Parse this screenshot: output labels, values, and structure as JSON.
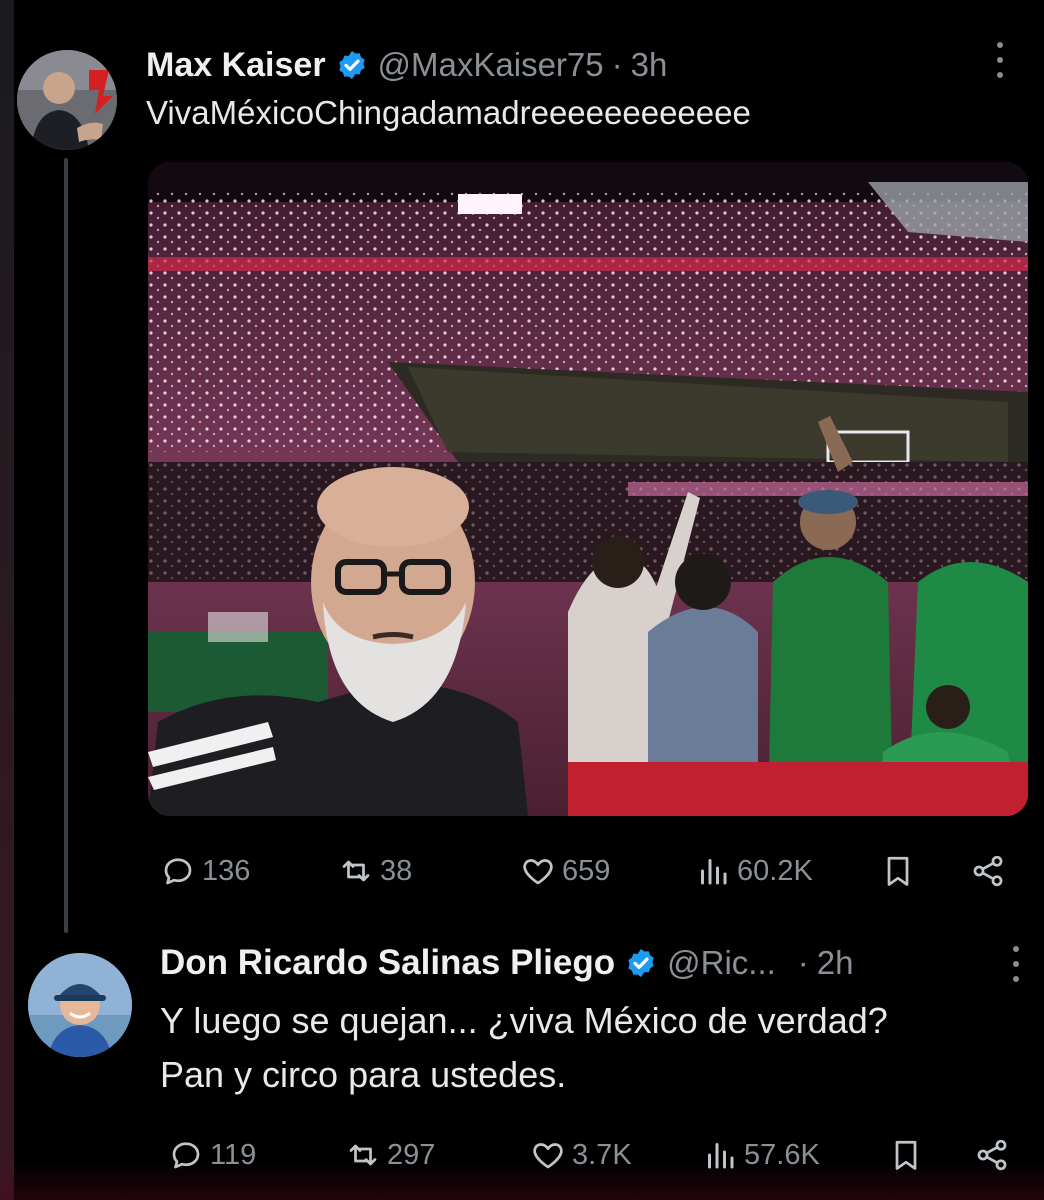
{
  "tweets": [
    {
      "name": "Max Kaiser",
      "handle": "@MaxKaiser75",
      "separator": "·",
      "time": "3h",
      "text": "VivaMéxicoChingadamadreeeeeeeeeeee",
      "has_media": true,
      "stats": {
        "replies": "136",
        "reposts": "38",
        "likes": "659",
        "views": "60.2K"
      }
    },
    {
      "name": "Don Ricardo Salinas Pliego",
      "handle": "@Ric...",
      "separator": "·",
      "time": "2h",
      "text_line1": "Y luego se quejan... ¿viva México de verdad?",
      "text_line2": "Pan y circo para ustedes.",
      "stats": {
        "replies": "119",
        "reposts": "297",
        "likes": "3.7K",
        "views": "57.6K"
      }
    }
  ],
  "colors": {
    "background": "#000000",
    "text": "#e7e9ea",
    "muted": "#8a9096",
    "verified": "#1d9bf0"
  },
  "icons": [
    "reply-icon",
    "repost-icon",
    "like-icon",
    "views-icon",
    "bookmark-icon",
    "share-icon",
    "verified-badge-icon",
    "more-icon"
  ]
}
